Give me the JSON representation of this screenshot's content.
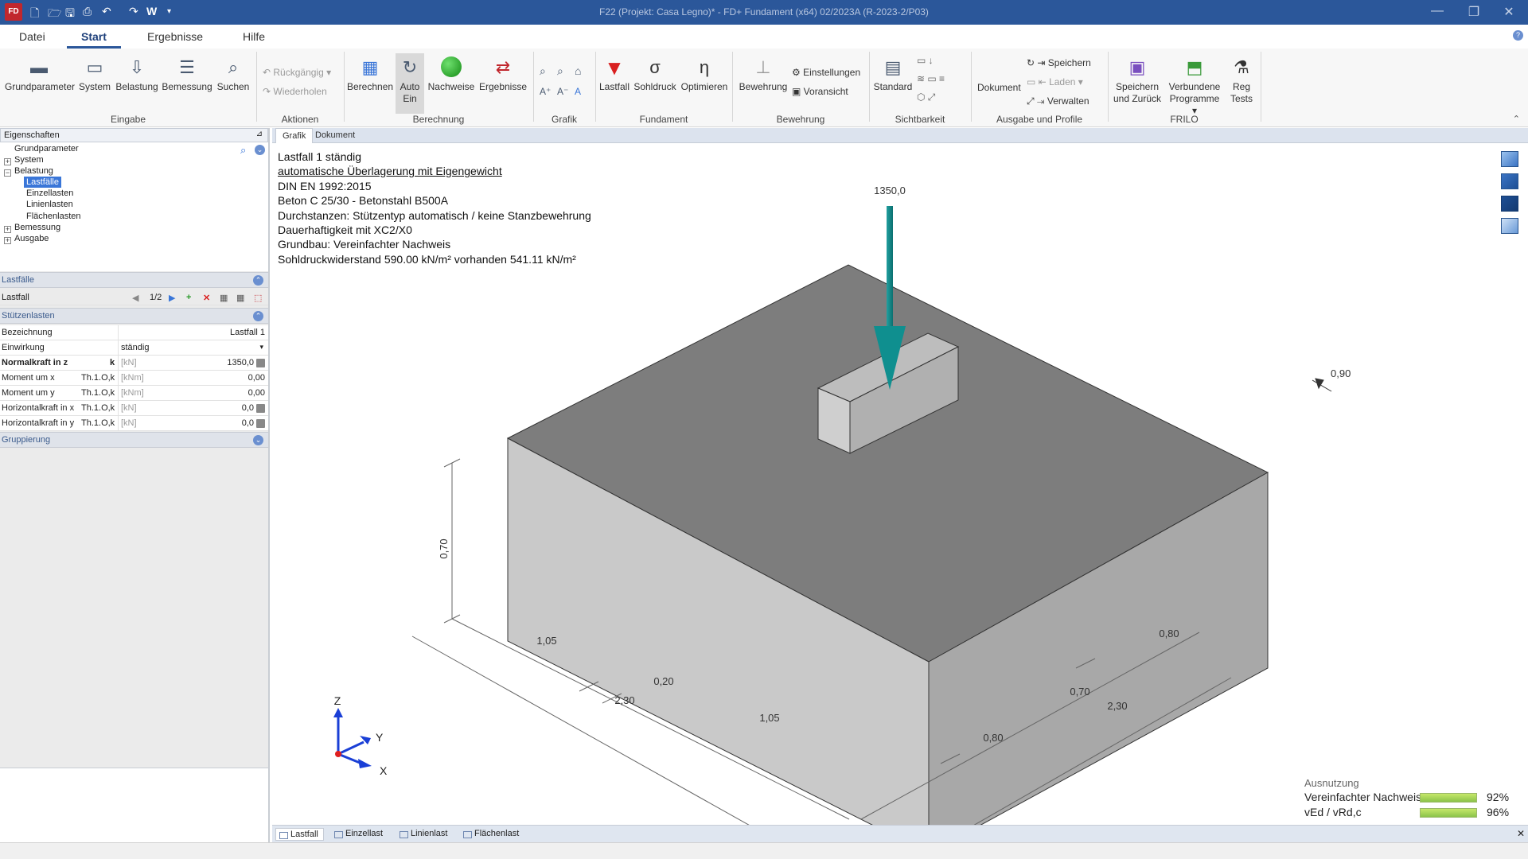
{
  "titlebar": {
    "app_icon": "FD",
    "title": "F22 (Projekt: Casa Legno)* - FD+ Fundament (x64) 02/2023A (R-2023-2/P03)",
    "w_label": "W"
  },
  "menu": {
    "tabs": [
      "Datei",
      "Start",
      "Ergebnisse",
      "Hilfe"
    ],
    "active": "Start"
  },
  "ribbon": {
    "eingabe": {
      "label": "Eingabe",
      "buttons": [
        "Grundparameter",
        "System",
        "Belastung",
        "Bemessung",
        "Suchen"
      ]
    },
    "aktionen": {
      "label": "Aktionen",
      "undo": "Rückgängig",
      "redo": "Wiederholen"
    },
    "berechnung": {
      "label": "Berechnung",
      "berechnen": "Berechnen",
      "auto_line1": "Auto",
      "auto_line2": "Ein",
      "nachweise": "Nachweise",
      "ergebnisse": "Ergebnisse"
    },
    "grafik": {
      "label": "Grafik"
    },
    "fundament": {
      "label": "Fundament",
      "lastfall": "Lastfall",
      "sohldruck": "Sohldruck",
      "optimieren": "Optimieren"
    },
    "bewehrung": {
      "label": "Bewehrung",
      "bewehrung": "Bewehrung",
      "einstellungen": "Einstellungen",
      "voransicht": "Voransicht"
    },
    "sichtbarkeit": {
      "label": "Sichtbarkeit",
      "standard": "Standard"
    },
    "ausgabe": {
      "label": "Ausgabe und Profile",
      "dokument": "Dokument",
      "speichern": "Speichern",
      "laden": "Laden",
      "verwalten": "Verwalten"
    },
    "frilo": {
      "label": "FRILO",
      "speichern_l1": "Speichern",
      "speichern_l2": "und Zurück",
      "verbunden_l1": "Verbundene",
      "verbunden_l2": "Programme",
      "reg_l1": "Reg",
      "reg_l2": "Tests"
    }
  },
  "left": {
    "header": "Eigenschaften",
    "tree": {
      "grundparameter": "Grundparameter",
      "system": "System",
      "belastung": "Belastung",
      "lastfaelle": "Lastfälle",
      "einzellasten": "Einzellasten",
      "linienlasten": "Linienlasten",
      "flaechenlasten": "Flächenlasten",
      "bemessung": "Bemessung",
      "ausgabe": "Ausgabe"
    },
    "lastfaelle_section": "Lastfälle",
    "lastfall_label": "Lastfall",
    "lastfall_nav": "1/2",
    "stuetzenlasten_section": "Stützenlasten",
    "rows": [
      {
        "name": "Bezeichnung",
        "tag": "",
        "unit": "",
        "value": "Lastfall 1"
      },
      {
        "name": "Einwirkung",
        "tag": "",
        "unit": "",
        "value": "ständig"
      },
      {
        "name": "Normalkraft in z",
        "tag": "k",
        "unit": "[kN]",
        "value": "1350,0"
      },
      {
        "name": "Moment um x",
        "tag": "Th.1.O,k",
        "unit": "[kNm]",
        "value": "0,00"
      },
      {
        "name": "Moment um y",
        "tag": "Th.1.O,k",
        "unit": "[kNm]",
        "value": "0,00"
      },
      {
        "name": "Horizontalkraft in x",
        "tag": "Th.1.O,k",
        "unit": "[kN]",
        "value": "0,0"
      },
      {
        "name": "Horizontalkraft in y",
        "tag": "Th.1.O,k",
        "unit": "[kN]",
        "value": "0,0"
      }
    ],
    "gruppierung_section": "Gruppierung"
  },
  "doc_tabs": [
    "Grafik",
    "Dokument"
  ],
  "info_lines": [
    "Lastfall 1 ständig",
    "automatische Überlagerung mit Eigengewicht",
    "DIN EN 1992:2015",
    "Beton C 25/30 - Betonstahl B500A",
    "Durchstanzen: Stützentyp automatisch / keine Stanzbewehrung",
    "Dauerhaftigkeit mit XC2/X0",
    "Grundbau: Vereinfachter Nachweis",
    "Sohldruckwiderstand 590.00 kN/m² vorhanden 541.11 kN/m²"
  ],
  "model": {
    "load_value": "1350,0",
    "level_mark": "0,90",
    "dim_height": "0,70",
    "dim_a1": "1,05",
    "dim_a2": "0,20",
    "dim_a3": "1,05",
    "dim_a_total": "2,30",
    "dim_b1": "0,80",
    "dim_b2": "0,70",
    "dim_b3": "0,80",
    "dim_b_total": "2,30",
    "axis_z": "Z",
    "axis_y": "Y",
    "axis_x": "X"
  },
  "ausnutzung": {
    "title": "Ausnutzung",
    "rows": [
      {
        "label": "Vereinfachter Nachweis ULS",
        "value": "92%",
        "fraction": 0.92
      },
      {
        "label": "vEd / vRd,c",
        "value": "96%",
        "fraction": 0.96
      }
    ]
  },
  "bottom_tabs": [
    "Lastfall",
    "Einzellast",
    "Linienlast",
    "Flächenlast"
  ],
  "colors": {
    "titlebar": "#2b579a",
    "arrow": "#0f8f8f",
    "top_face": "#7a7a7a",
    "front_face": "#c8c8c8",
    "side_face": "#a9a9a9",
    "accent": "#3a76d8"
  }
}
